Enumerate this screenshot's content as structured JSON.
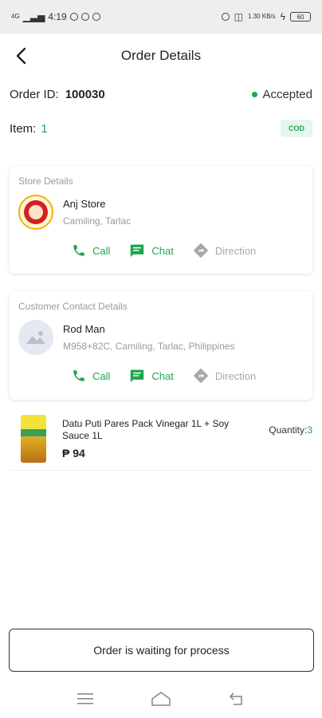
{
  "status_bar": {
    "time": "4:19",
    "signal": "4G",
    "speed": "1.30 KB/s",
    "battery": "60"
  },
  "header": {
    "title": "Order Details",
    "back_icon": "back-arrow-icon"
  },
  "order": {
    "id_label": "Order ID:",
    "id": "100030",
    "status": "Accepted",
    "item_label": "Item:",
    "item_count": "1",
    "payment_badge": "COD"
  },
  "store": {
    "section_label": "Store Details",
    "name": "Anj Store",
    "address": "Camiling, Tarlac"
  },
  "customer": {
    "section_label": "Customer Contact Details",
    "name": "Rod Man",
    "address": "M958+82C, Camiling, Tarlac, Philippines"
  },
  "actions": {
    "call": "Call",
    "chat": "Chat",
    "direction": "Direction"
  },
  "product": {
    "name": "Datu Puti Pares Pack Vinegar 1L + Soy Sauce 1L",
    "price": "₱ 94",
    "qty_label": "Quantity:",
    "qty": "3"
  },
  "bottom_button": {
    "label": "Order is waiting for process"
  },
  "colors": {
    "accent": "#1aa84a",
    "muted": "#9a9a9a"
  }
}
